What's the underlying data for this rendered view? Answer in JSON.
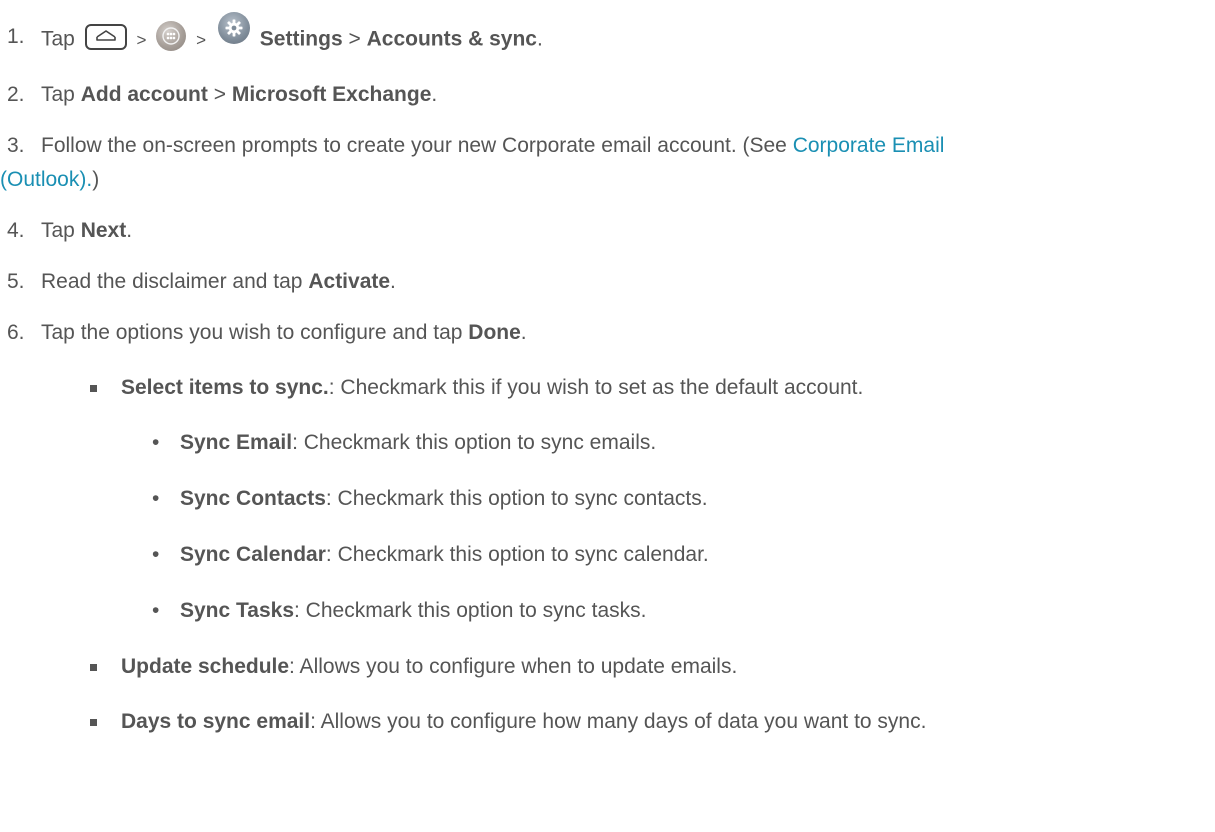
{
  "steps": [
    {
      "num": "1.",
      "tap": "Tap",
      "sep1": ">",
      "sep2": ">",
      "settings": "Settings",
      "sep3": ">",
      "accounts": "Accounts & sync",
      "end": "."
    },
    {
      "num": "2.",
      "tap": "Tap",
      "add_account": "Add account",
      "sep": ">",
      "exchange": "Microsoft Exchange",
      "end": "."
    },
    {
      "num": "3.",
      "text": "Follow the on-screen prompts to create your new Corporate email account. (See",
      "link_part1": "Corporate Email",
      "link_part2": "(Outlook).",
      "after": ")"
    },
    {
      "num": "4.",
      "tap": "Tap",
      "bold": "Next",
      "end": "."
    },
    {
      "num": "5.",
      "text": "Read the disclaimer and tap",
      "bold": "Activate",
      "end": "."
    },
    {
      "num": "6.",
      "text": "Tap the options you wish to configure and tap",
      "bold": "Done",
      "end": "."
    }
  ],
  "options": [
    {
      "bold": "Select items to sync.",
      "text": ": Checkmark this if you wish to set as the default account."
    },
    {
      "bold": "Update schedule",
      "text": ": Allows you to configure when to update emails."
    },
    {
      "bold": "Days to sync email",
      "text": ": Allows you to configure how many days of data you want to sync."
    }
  ],
  "sync_items": [
    {
      "bullet": "•",
      "bold": "Sync Email",
      "text": ": Checkmark this option to sync emails."
    },
    {
      "bullet": "•",
      "bold": "Sync Contacts",
      "text": ": Checkmark this option to sync contacts."
    },
    {
      "bullet": "•",
      "bold": "Sync Calendar",
      "text": ": Checkmark this option to sync calendar."
    },
    {
      "bullet": "•",
      "bold": "Sync Tasks",
      "text": ": Checkmark this option to sync tasks."
    }
  ],
  "icons": [
    "home-key-icon",
    "apps-icon",
    "settings-icon"
  ],
  "colors": {
    "text": "#555555",
    "link": "#1a8fb3"
  }
}
